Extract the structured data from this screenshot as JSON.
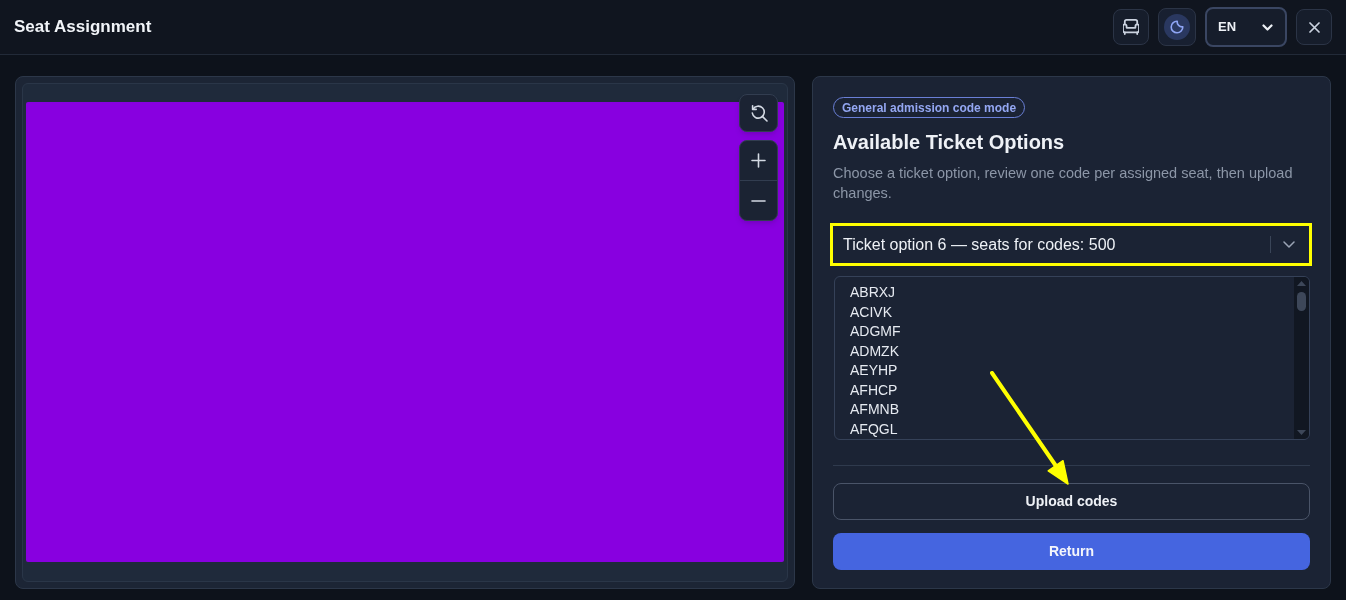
{
  "header": {
    "title": "Seat Assignment",
    "theme_toggle": {
      "on": true
    },
    "language_select": {
      "value": "EN"
    }
  },
  "ticket_panel": {
    "badge": "General admission code mode",
    "title": "Available Ticket Options",
    "description": "Choose a ticket option, review one code per assigned seat, then upload changes.",
    "ticket_select": {
      "value": "Ticket option 6 — seats for codes: 500",
      "highlighted": true
    },
    "codes": [
      "ABRXJ",
      "ACIVK",
      "ADGMF",
      "ADMZK",
      "AEYHP",
      "AFHCP",
      "AFMNB",
      "AFQGL"
    ],
    "upload_button": {
      "label": "Upload codes",
      "arrow_pointing": true
    },
    "return_button": {
      "label": "Return"
    }
  }
}
